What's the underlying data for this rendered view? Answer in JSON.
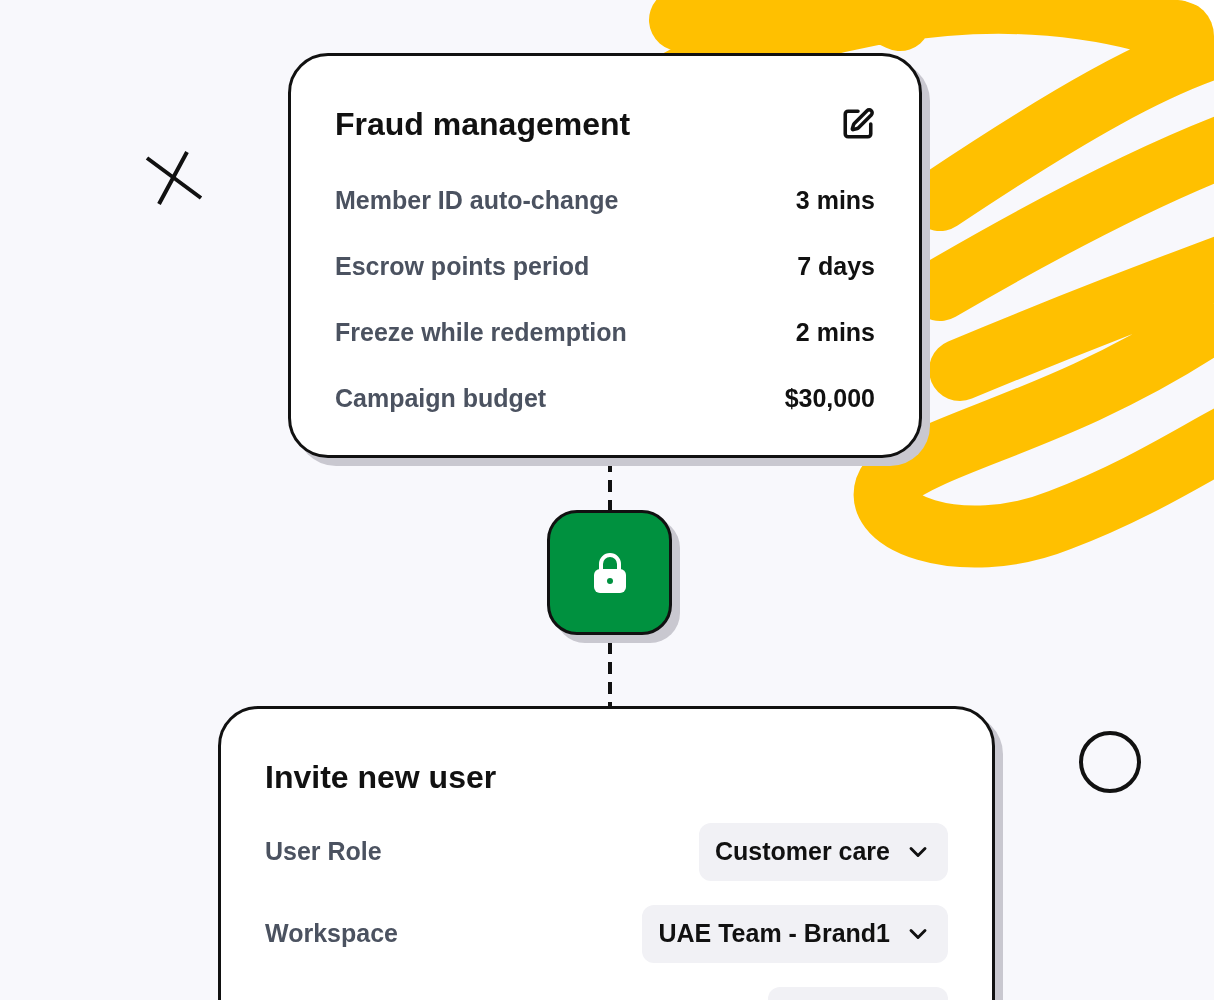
{
  "fraud_card": {
    "title": "Fraud management",
    "rows": [
      {
        "label": "Member ID auto-change",
        "value": "3 mins"
      },
      {
        "label": "Escrow points period",
        "value": "7 days"
      },
      {
        "label": "Freeze while redemption",
        "value": "2 mins"
      },
      {
        "label": "Campaign budget",
        "value": "$30,000"
      }
    ]
  },
  "invite_card": {
    "title": "Invite new user",
    "fields": [
      {
        "label": "User Role",
        "value": "Customer care"
      },
      {
        "label": "Workspace",
        "value": "UAE Team - Brand1"
      }
    ]
  }
}
